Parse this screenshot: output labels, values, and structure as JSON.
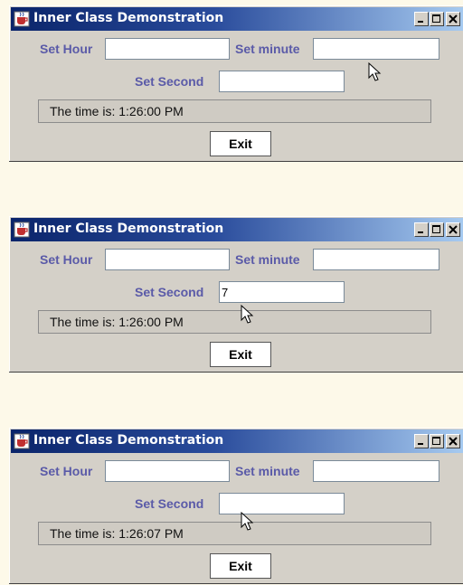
{
  "windows": [
    {
      "title": "Inner Class Demonstration",
      "set_hour_label": "Set Hour",
      "set_minute_label": "Set minute",
      "set_second_label": "Set Second",
      "hour_value": "",
      "minute_value": "",
      "second_value": "",
      "display_text": "The time is: 1:26:00 PM",
      "exit_label": "Exit"
    },
    {
      "title": "Inner Class Demonstration",
      "set_hour_label": "Set Hour",
      "set_minute_label": "Set minute",
      "set_second_label": "Set Second",
      "hour_value": "",
      "minute_value": "",
      "second_value": "7",
      "display_text": "The time is: 1:26:00 PM",
      "exit_label": "Exit"
    },
    {
      "title": "Inner Class Demonstration",
      "set_hour_label": "Set Hour",
      "set_minute_label": "Set minute",
      "set_second_label": "Set Second",
      "hour_value": "",
      "minute_value": "",
      "second_value": "",
      "display_text": "The time is: 1:26:07 PM",
      "exit_label": "Exit"
    }
  ],
  "colors": {
    "background": "#fdf9e9",
    "window_face": "#d4d0c8",
    "title_gradient_start": "#0a246a",
    "title_gradient_end": "#a6caf0",
    "label_color": "#5a5aa8"
  },
  "icons": {
    "app": "java-cup-icon",
    "minimize": "minimize-icon",
    "maximize": "maximize-icon",
    "close": "close-icon",
    "pointer": "mouse-pointer-icon"
  }
}
